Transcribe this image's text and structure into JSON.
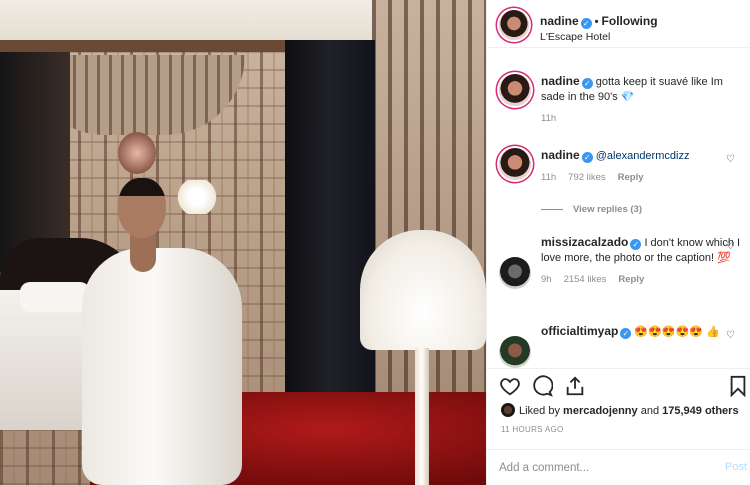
{
  "post": {
    "author": "nadine",
    "follow_status": "Following",
    "location": "L'Escape Hotel",
    "caption": "gotta keep it suavé like Im sade in the 90's 💎",
    "caption_time": "11h"
  },
  "comments": [
    {
      "user": "nadine",
      "text": "@alexandermcdizz",
      "time": "11h",
      "likes": "792 likes",
      "reply": "Reply",
      "view_replies": "View replies (3)"
    },
    {
      "user": "missizacalzado",
      "text": "I don't know which I love more, the photo or the caption! 💯",
      "time": "9h",
      "likes": "2154 likes",
      "reply": "Reply"
    },
    {
      "user": "officialtimyap",
      "text": "😍😍😍😍😍 👍",
      "time": "",
      "likes": "",
      "reply": ""
    }
  ],
  "stats": {
    "liked_by_prefix": "Liked by",
    "liked_by_user": "mercadojenny",
    "liked_by_joiner": "and",
    "liked_by_others": "175,949 others",
    "timestamp": "11 HOURS AGO"
  },
  "add_comment": {
    "placeholder": "Add a comment...",
    "post_label": "Post"
  },
  "icons": {
    "verified": "verified-badge-icon",
    "like": "heart-icon",
    "comment": "comment-bubble-icon",
    "share": "share-icon",
    "save": "bookmark-icon"
  },
  "colors": {
    "verified": "#3897f0",
    "story_ring": "#d62976",
    "post_disabled": "#b3dbff",
    "muted": "#8e8e8e"
  }
}
